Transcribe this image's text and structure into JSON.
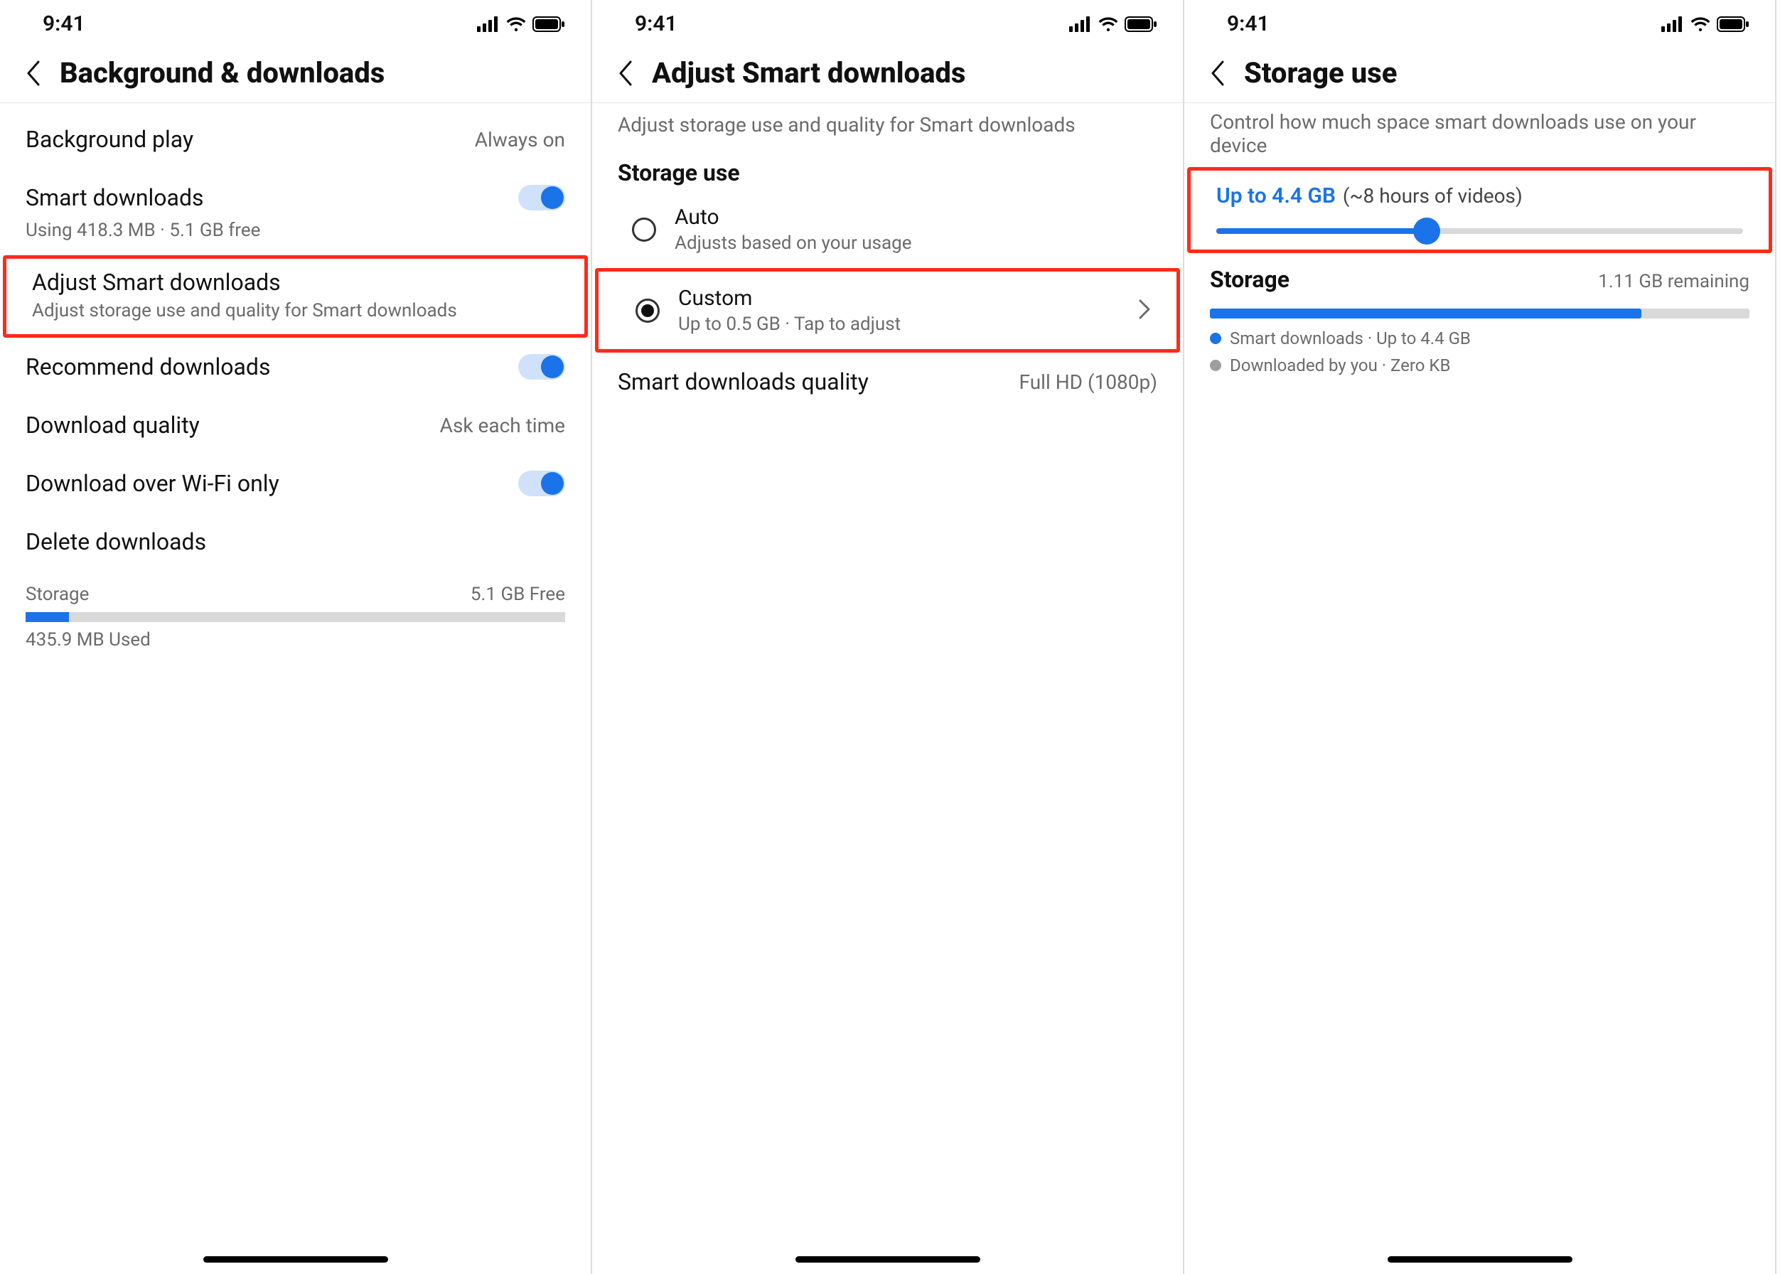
{
  "status": {
    "time": "9:41"
  },
  "screen1": {
    "title": "Background & downloads",
    "rows": {
      "bg_play": {
        "title": "Background play",
        "value": "Always on"
      },
      "smart_dl": {
        "title": "Smart downloads",
        "sub": "Using 418.3 MB · 5.1 GB free"
      },
      "adjust": {
        "title": "Adjust Smart downloads",
        "sub": "Adjust storage use and quality for Smart downloads"
      },
      "recommend": {
        "title": "Recommend downloads"
      },
      "dl_quality": {
        "title": "Download quality",
        "value": "Ask each time"
      },
      "wifi_only": {
        "title": "Download over Wi-Fi only"
      },
      "delete": {
        "title": "Delete downloads"
      }
    },
    "storage": {
      "label": "Storage",
      "free": "5.1 GB Free",
      "used_caption": "435.9 MB Used",
      "used_pct": 8
    }
  },
  "screen2": {
    "title": "Adjust Smart downloads",
    "sub": "Adjust storage use and quality for Smart downloads",
    "section": "Storage use",
    "auto": {
      "title": "Auto",
      "sub": "Adjusts based on your usage"
    },
    "custom": {
      "title": "Custom",
      "sub": "Up to 0.5 GB · Tap to adjust"
    },
    "quality": {
      "title": "Smart downloads quality",
      "value": "Full HD (1080p)"
    }
  },
  "screen3": {
    "title": "Storage use",
    "sub": "Control how much space smart downloads use on your device",
    "slider": {
      "value_label": "Up to 4.4 GB",
      "hint": "(~8 hours of videos)",
      "pct": 40
    },
    "storage": {
      "label": "Storage",
      "remaining": "1.11 GB remaining",
      "used_pct": 80
    },
    "legend1": "Smart downloads · Up to 4.4 GB",
    "legend2": "Downloaded by you · Zero KB"
  }
}
